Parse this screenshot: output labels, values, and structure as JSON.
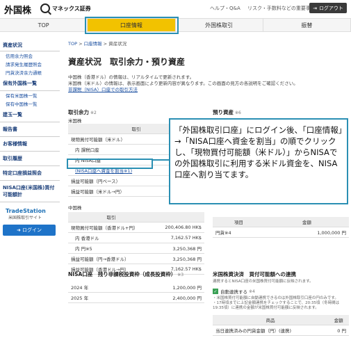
{
  "header": {
    "logo": "外国株",
    "brand": "マネックス証券",
    "links": [
      "ヘルプ・Q&A",
      "リスク・手数料などの重要事項"
    ],
    "logout_label": "ログアウト"
  },
  "nav": {
    "tabs": [
      {
        "label": "TOP"
      },
      {
        "label": "口座情報"
      },
      {
        "label": "外国株取引"
      },
      {
        "label": "振替"
      }
    ]
  },
  "sidebar": {
    "section1": "資産状況",
    "items1": [
      "信用余力照会",
      "請求発生履歴照会",
      "円貨決済余力通帳"
    ],
    "section2": "保有外国株一覧",
    "items2": [
      "保有米国株一覧",
      "保有中国株一覧"
    ],
    "sections": [
      "建玉一覧",
      "報告書",
      "お客様情報",
      "取引履歴",
      "特定口座損益照会",
      "NISA口座(米国株)買付可能額計"
    ],
    "tradestation": "TradeStation",
    "tradestation_sub": "米国株取引サイト",
    "login_label": "ログイン"
  },
  "main": {
    "breadcrumb": [
      "TOP",
      "口座情報",
      "資産状況"
    ],
    "title": "資産状況　取引余力・預り資産",
    "intro_line1": "中国株（香港ドル）の情報は、リアルタイムで更新されます。",
    "intro_line2": "米国株（米ドル）の情報は、表示画面により更新内容が異なります。この画面の見方の各説明をご確認ください。",
    "intro_link": "非課税（NISA）口座での取引方法",
    "left_title": "取引余力",
    "left_note": "※2",
    "left_sub": "米国株",
    "left_header": "取引",
    "us_rows": [
      "現物買付可能額（米ドル）",
      "内 課税口座",
      "内 NISA口座",
      "(NISA口座へ資金を割当※1)",
      "損益可能額（円ベース）",
      "損益可能額（米ドル→円）"
    ],
    "cn_label": "中国株",
    "cn_rows": [
      {
        "label": "現物買付可能額（香港ドル+円）",
        "value": "200,406.80 HK$"
      },
      {
        "label": "内 香港ドル",
        "value": "7,162.57 HK$"
      },
      {
        "label": "内 円※5",
        "value": "3,250,368 円"
      },
      {
        "label": "損益可能額（円→香港ドル）",
        "value": "3,250,368 円"
      },
      {
        "label": "損益可能額（香港ドル→円）",
        "value": "7,162.57 HK$"
      }
    ],
    "right_title": "預り資産",
    "right_note": "※6",
    "deposit": {
      "col1": "項目",
      "col2": "金額",
      "label": "円貨※4",
      "value": "1,000,000 円"
    },
    "nisa_title": "NISA口座　残り非課税投資枠（成長投資枠）",
    "nisa_note": "※3",
    "nisa_rows": [
      {
        "year": "2024 年",
        "value": "1,200,000 円"
      },
      {
        "year": "2025 年",
        "value": "2,400,000 円"
      }
    ],
    "usd_title": "米国株資決済　買付可能額への連携",
    "usd_desc": "連携するとNISA口座の米国株買付可能額に反映されます。",
    "auto_label": "自動連携する",
    "auto_note": "※4",
    "usd_notes": "・米国株買付可能額に自動連携できるのは外国株取引口座の円のみです。\n・17時頃までに上記金額連携をチェックすることで、20:35頃（冬時間は19:35頃）に連携の金額が米国株買付可能額に反映されます。",
    "usd_table": {
      "col1": "商品",
      "col2": "金額",
      "label": "当日連携済みの円貨金額（円）(連携)",
      "value": "0 円"
    }
  },
  "callout": "「外国株取引口座」にログイン後、「口座情報」→「NISA口座へ資金を割当」の順でクリックし、「現物買付可能額（米ドル）」からNISAでの外国株取引に利用する米ドル資金を、NISA口座へ割り当てます。"
}
